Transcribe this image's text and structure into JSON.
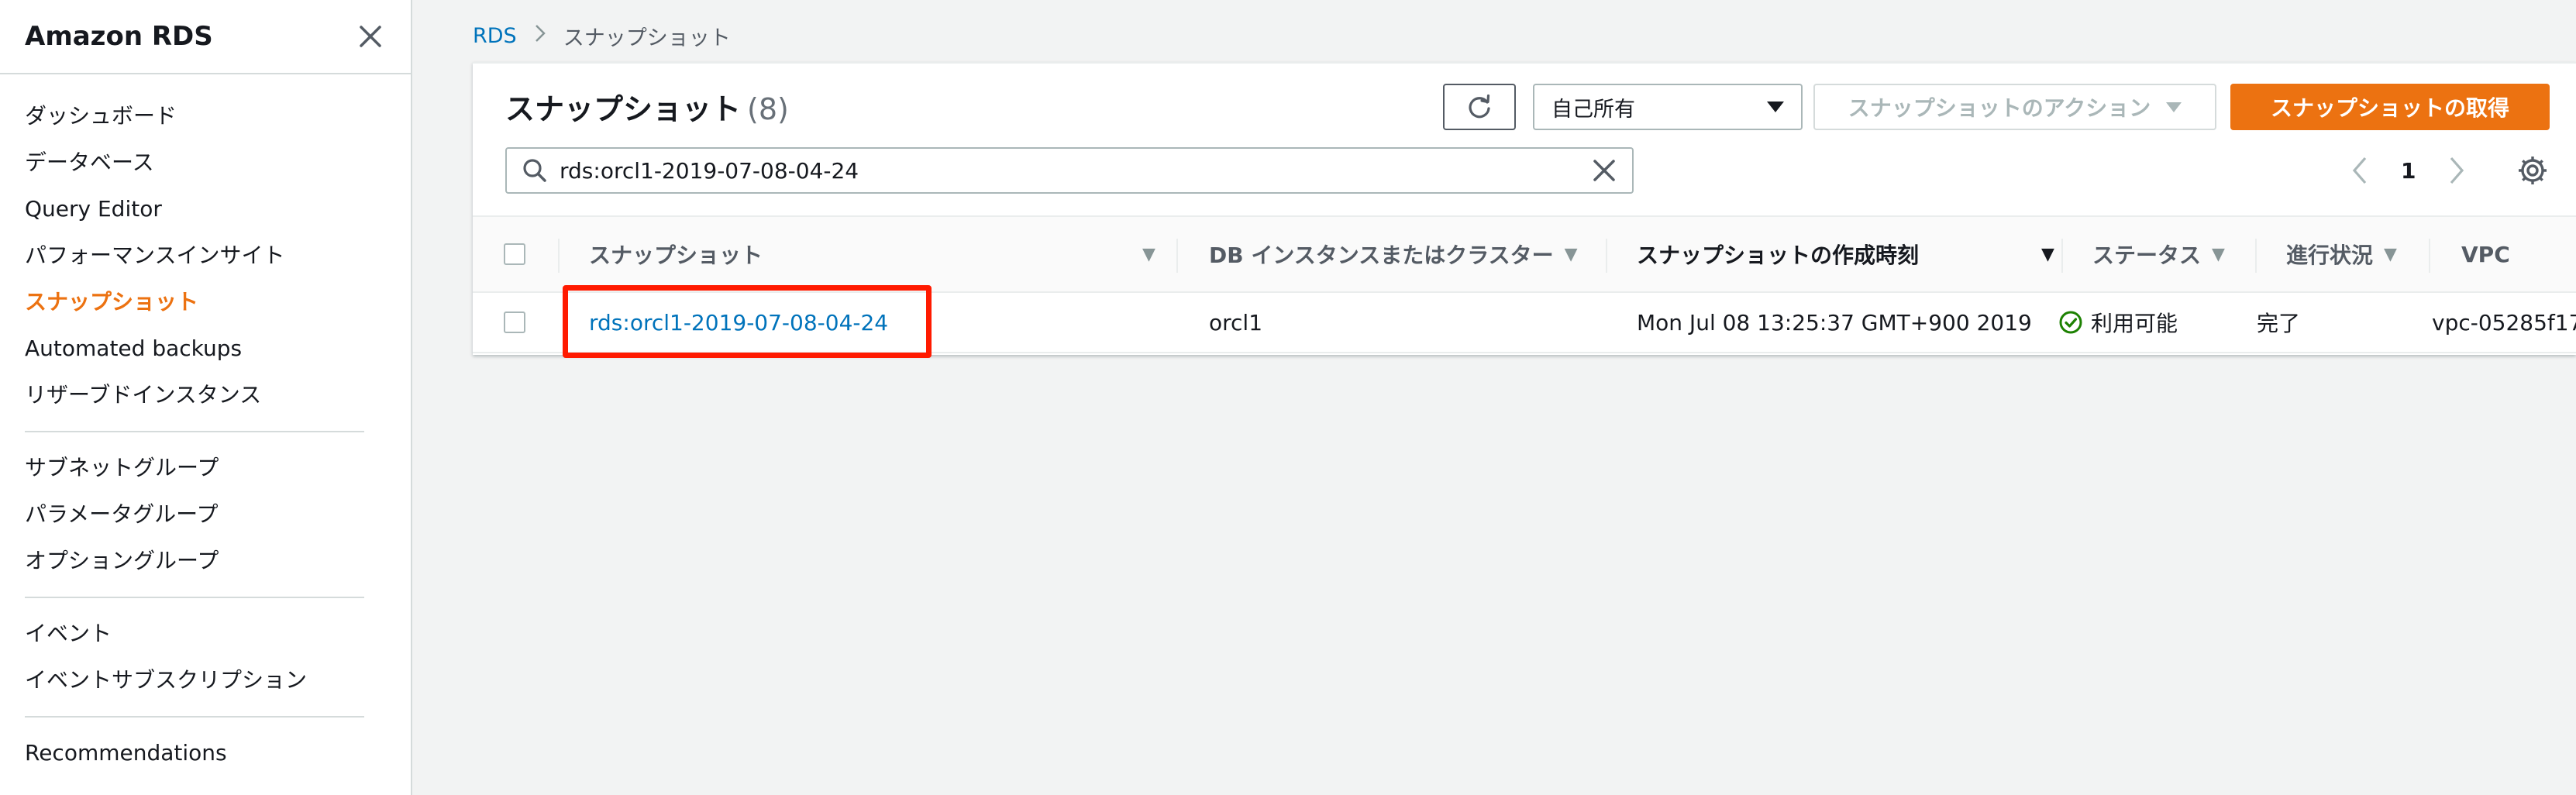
{
  "sidebar": {
    "title": "Amazon RDS",
    "items": [
      {
        "label": "ダッシュボード"
      },
      {
        "label": "データベース"
      },
      {
        "label": "Query Editor"
      },
      {
        "label": "パフォーマンスインサイト"
      },
      {
        "label": "スナップショット",
        "active": true
      },
      {
        "label": "Automated backups"
      },
      {
        "label": "リザーブドインスタンス"
      },
      {
        "label": "サブネットグループ"
      },
      {
        "label": "パラメータグループ"
      },
      {
        "label": "オプショングループ"
      },
      {
        "label": "イベント"
      },
      {
        "label": "イベントサブスクリプション"
      },
      {
        "label": "Recommendations"
      }
    ]
  },
  "breadcrumb": {
    "root": "RDS",
    "current": "スナップショット"
  },
  "panel": {
    "title": "スナップショット",
    "count": "(8)",
    "owner_select": "自己所有",
    "actions_label": "スナップショットのアクション",
    "take_snapshot_label": "スナップショットの取得",
    "search_value": "rds:orcl1-2019-07-08-04-24",
    "page": "1"
  },
  "table": {
    "columns": [
      "スナップショット",
      "DB インスタンスまたはクラスター",
      "スナップショットの作成時刻",
      "ステータス",
      "進行状況",
      "VPC"
    ],
    "rows": [
      {
        "snapshot": "rds:orcl1-2019-07-08-04-24",
        "instance": "orcl1",
        "created": "Mon Jul 08 13:25:37 GMT+900 2019",
        "status": "利用可能",
        "progress": "完了",
        "vpc": "vpc-05285f17"
      }
    ]
  },
  "colors": {
    "accent": "#ec7211",
    "link": "#0073bb",
    "success": "#1d8102",
    "highlight": "#ff1a00"
  }
}
